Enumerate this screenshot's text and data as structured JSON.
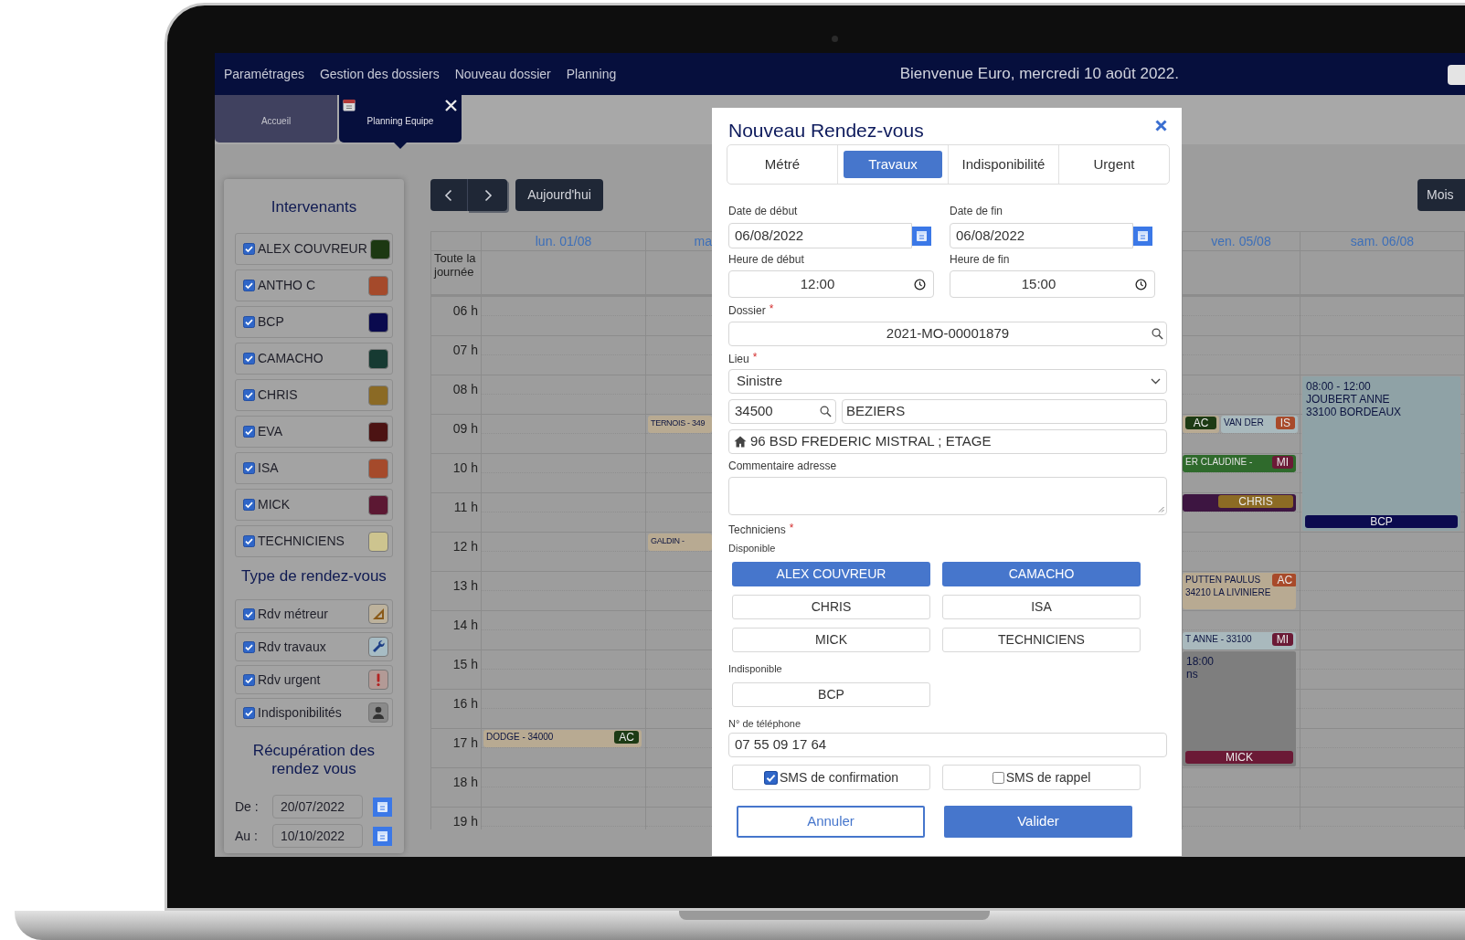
{
  "nav": {
    "menu": [
      {
        "label": "Paramétrages"
      },
      {
        "label": "Gestion des dossiers"
      },
      {
        "label": "Nouveau dossier"
      },
      {
        "label": "Planning"
      }
    ],
    "welcome": "Bienvenue Euro, mercredi 10 août 2022."
  },
  "tabs": [
    {
      "label": "Accueil",
      "selected": false
    },
    {
      "label": "Planning Equipe",
      "selected": true
    }
  ],
  "sidebar": {
    "intervenants_title": "Intervenants",
    "intervenants": [
      {
        "label": "ALEX COUVREUR",
        "checked": true,
        "color": "#1c3812"
      },
      {
        "label": "ANTHO C",
        "checked": true,
        "color": "#a54a2b"
      },
      {
        "label": "BCP",
        "checked": true,
        "color": "#0a0a4e"
      },
      {
        "label": "CAMACHO",
        "checked": true,
        "color": "#163a32"
      },
      {
        "label": "CHRIS",
        "checked": true,
        "color": "#8b6a25"
      },
      {
        "label": "EVA",
        "checked": true,
        "color": "#4c1313"
      },
      {
        "label": "ISA",
        "checked": true,
        "color": "#a54a2b"
      },
      {
        "label": "MICK",
        "checked": true,
        "color": "#5c1833"
      },
      {
        "label": "TECHNICIENS",
        "checked": true,
        "color": "#cdc48f"
      }
    ],
    "types_title": "Type de rendez-vous",
    "types": [
      {
        "label": "Rdv métreur",
        "checked": true,
        "kind": "metreur"
      },
      {
        "label": "Rdv travaux",
        "checked": true,
        "kind": "travaux"
      },
      {
        "label": "Rdv urgent",
        "checked": true,
        "kind": "urgent"
      },
      {
        "label": "Indisponibilités",
        "checked": true,
        "kind": "indisponibilite"
      }
    ],
    "recuperation_title": "Récupération des rendez vous",
    "range": [
      {
        "label": "De :",
        "value": "20/07/2022"
      },
      {
        "label": "Au :",
        "value": "10/10/2022"
      }
    ]
  },
  "toolbar": {
    "today": "Aujourd'hui",
    "view": "Mois"
  },
  "calendar": {
    "all_day_label": "Toute la journée",
    "hours": [
      "06 h",
      "07 h",
      "08 h",
      "09 h",
      "10 h",
      "11 h",
      "12 h",
      "13 h",
      "14 h",
      "15 h",
      "16 h",
      "17 h",
      "18 h",
      "19 h"
    ],
    "columns": [
      {
        "label": "lun. 01/08",
        "events": [
          {
            "kind": "chip",
            "color": "#b8aa92",
            "lines": [
              "DODGE - 34000"
            ],
            "badge": {
              "text": "AC",
              "color": "#1d3b14"
            }
          }
        ]
      },
      {
        "label": "ma",
        "events": [
          {
            "kind": "chip",
            "color": "#b8aa92",
            "lines": [
              "TERNOIS - 349"
            ]
          },
          {
            "kind": "chip",
            "color": "#b8aa92",
            "lines": [
              "GALDIN -"
            ]
          }
        ]
      },
      {
        "label": "ven. 05/08",
        "events": [
          {
            "kind": "chip",
            "color": "#b8aa92",
            "badge": {
              "text": "AC",
              "color": "#1d3b14"
            }
          },
          {
            "kind": "chip",
            "color": "#a9b9bd",
            "lines": [
              "VAN DER"
            ],
            "badge": {
              "text": "IS",
              "color": "#a84a2a"
            }
          },
          {
            "kind": "chip",
            "color": "#2f6a2c",
            "lines": [
              "ER CLAUDINE -"
            ],
            "badge": {
              "text": "MI",
              "color": "#6b1a36"
            }
          },
          {
            "kind": "chip",
            "color": "#3d1541",
            "badge": {
              "text": "CHRIS",
              "color": "#8c6b24"
            }
          },
          {
            "kind": "chip",
            "color": "#b8aa92",
            "lines": [
              "PUTTEN PAULUS",
              "34210 LA LIVINIERE"
            ],
            "badge": {
              "text": "AC",
              "color": "#a84a2a"
            }
          },
          {
            "kind": "chip",
            "color": "#a9b9bd",
            "lines": [
              "T ANNE - 33100"
            ],
            "badge": {
              "text": "MI",
              "color": "#6b1a36"
            }
          },
          {
            "kind": "block",
            "color": "#7e7e7e",
            "lines": [
              "18:00",
              "ns"
            ],
            "badge": {
              "text": "MICK",
              "color": "#6b1a36"
            }
          }
        ]
      },
      {
        "label": "sam. 06/08",
        "events": [
          {
            "kind": "block",
            "color": "#8fa2a6",
            "lines": [
              "08:00 - 12:00",
              "JOUBERT ANNE",
              "33100 BORDEAUX"
            ],
            "badge": {
              "text": "BCP",
              "color": "#0b0b4f"
            }
          }
        ]
      }
    ]
  },
  "modal": {
    "title": "Nouveau Rendez-vous",
    "tabs": [
      {
        "label": "Métré",
        "selected": false
      },
      {
        "label": "Travaux",
        "selected": true
      },
      {
        "label": "Indisponibilité",
        "selected": false
      },
      {
        "label": "Urgent",
        "selected": false
      }
    ],
    "start_date": {
      "label": "Date de début",
      "value": "06/08/2022"
    },
    "end_date": {
      "label": "Date de fin",
      "value": "06/08/2022"
    },
    "start_time": {
      "label": "Heure de début",
      "value": "12:00"
    },
    "end_time": {
      "label": "Heure de fin",
      "value": "15:00"
    },
    "dossier": {
      "label": "Dossier",
      "required_mark": "*",
      "value": "2021-MO-00001879"
    },
    "lieu": {
      "label": "Lieu",
      "required_mark": "*",
      "value": "Sinistre"
    },
    "postal_code": "34500",
    "city": "BEZIERS",
    "address": "96 BSD FREDERIC MISTRAL ; ETAGE",
    "comment": {
      "label": "Commentaire adresse"
    },
    "technicians": {
      "label": "Techniciens",
      "required_mark": "*",
      "available_label": "Disponible",
      "available": [
        {
          "label": "ALEX COUVREUR",
          "selected": true
        },
        {
          "label": "CAMACHO",
          "selected": true
        },
        {
          "label": "CHRIS",
          "selected": false
        },
        {
          "label": "ISA",
          "selected": false
        },
        {
          "label": "MICK",
          "selected": false
        },
        {
          "label": "TECHNICIENS",
          "selected": false
        }
      ],
      "unavailable_label": "Indisponible",
      "unavailable": [
        {
          "label": "BCP",
          "selected": false
        }
      ]
    },
    "phone": {
      "label": "N° de téléphone",
      "value": "07 55 09 17 64"
    },
    "sms": [
      {
        "label": "SMS de confirmation",
        "checked": true
      },
      {
        "label": "SMS de rappel",
        "checked": false
      }
    ],
    "buttons": [
      {
        "label": "Annuler",
        "kind": "secondary"
      },
      {
        "label": "Valider",
        "kind": "primary"
      }
    ]
  }
}
